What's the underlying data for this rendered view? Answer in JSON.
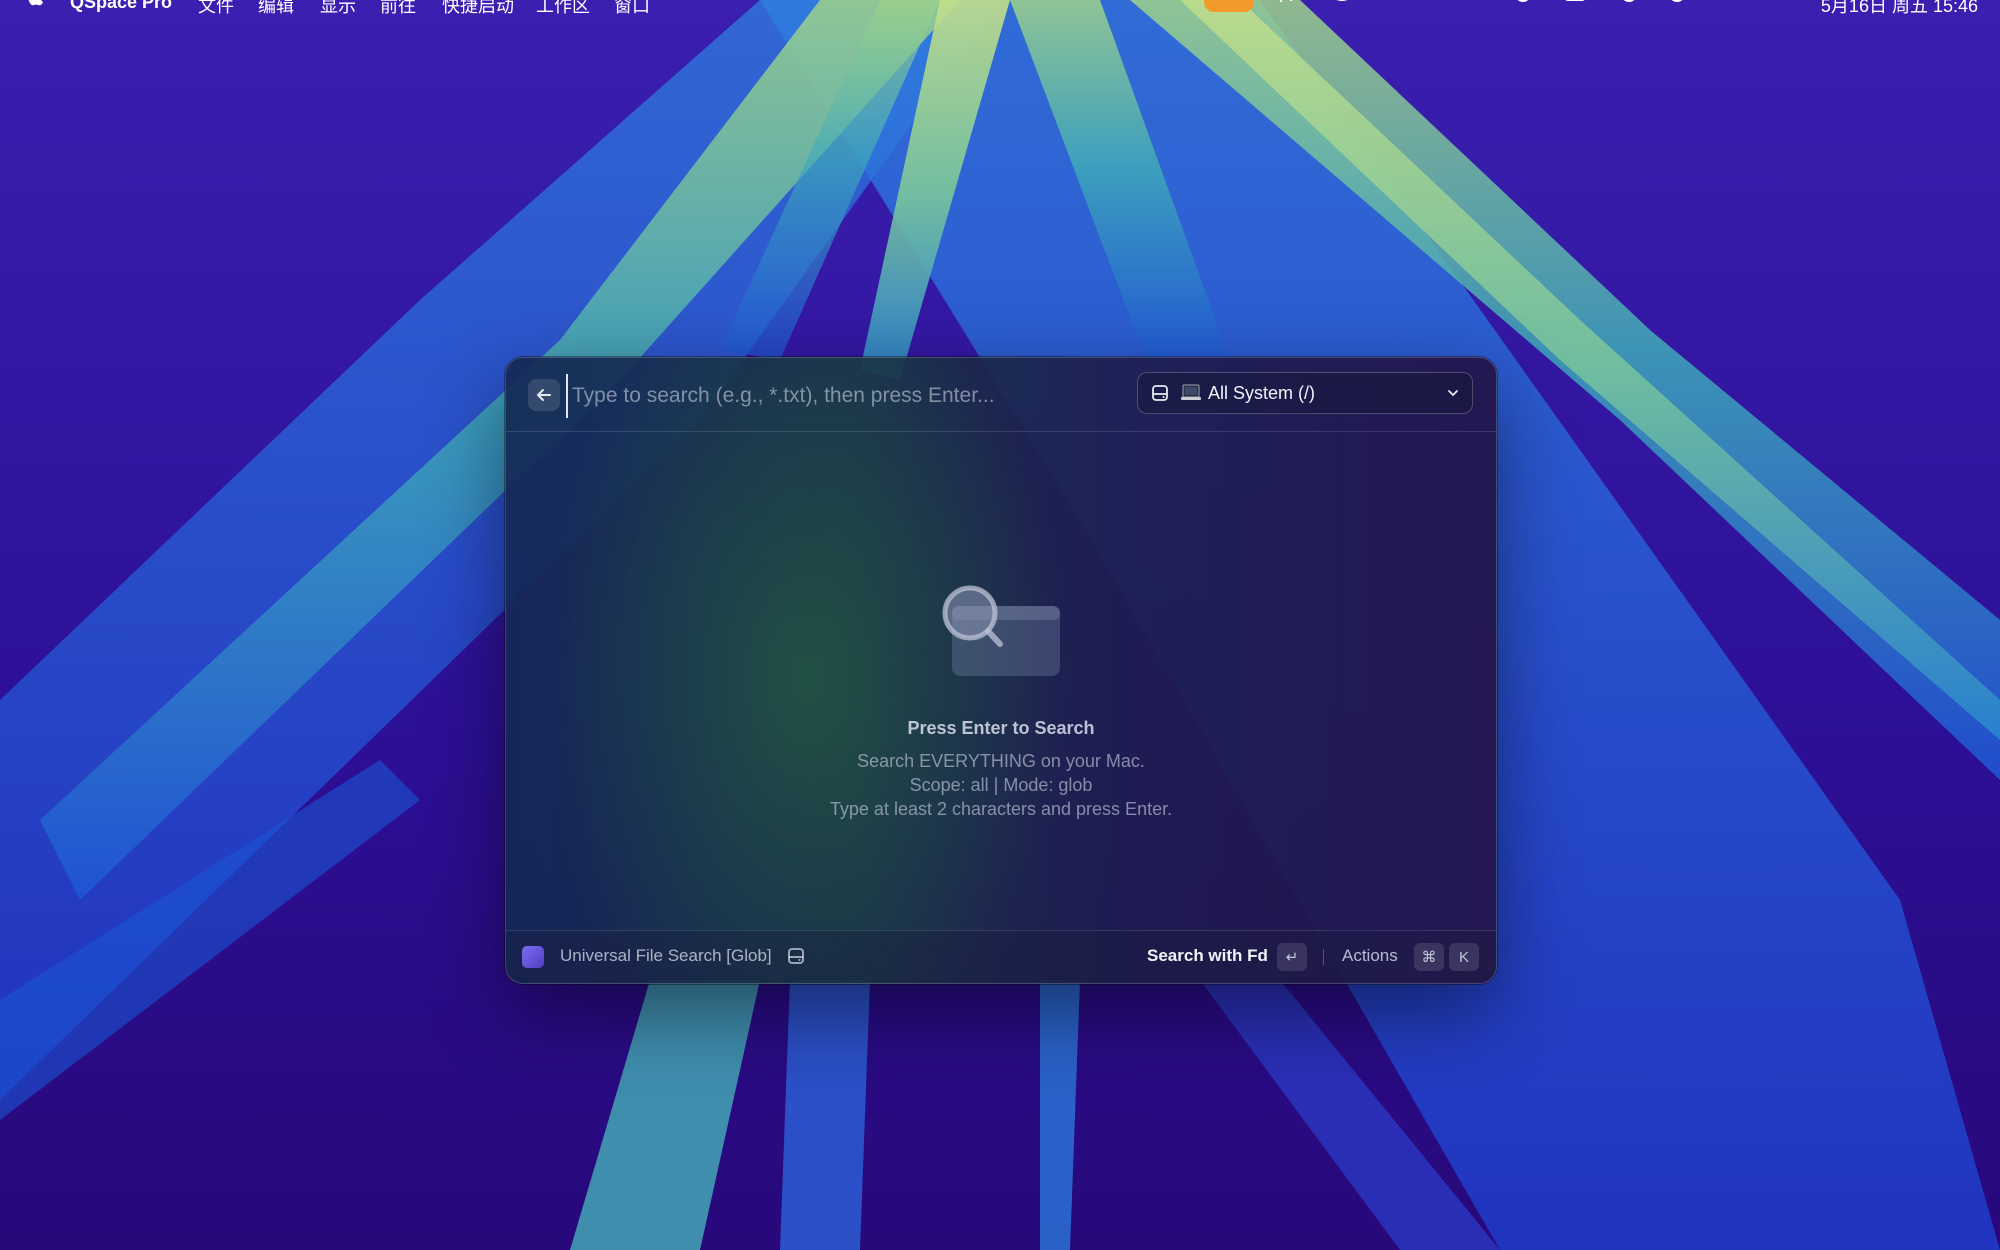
{
  "menubar": {
    "app_name": "QSpace Pro",
    "menus": [
      "文件",
      "编辑",
      "显示",
      "前往",
      "快捷启动",
      "工作区",
      "窗口"
    ],
    "clock": "5月16日 周五 15:46"
  },
  "search": {
    "placeholder": "Type to search (e.g., *.txt), then press Enter...",
    "value": "",
    "scope": {
      "label": "All System (/)",
      "icon": "laptop-icon"
    }
  },
  "empty_state": {
    "title": "Press Enter to Search",
    "line1": "Search EVERYTHING on your Mac.",
    "line2": "Scope: all | Mode: glob",
    "line3": "Type at least 2 characters and press Enter."
  },
  "footer": {
    "extension_name": "Universal File Search [Glob]",
    "primary_action": "Search with Fd",
    "enter_key": "↵",
    "actions_label": "Actions",
    "cmd_key": "⌘",
    "k_key": "K"
  },
  "colors": {
    "accent_orange": "#f39a2b",
    "extension_icon": "#6f60e6",
    "wallpaper_base": "#2a0f8f"
  }
}
